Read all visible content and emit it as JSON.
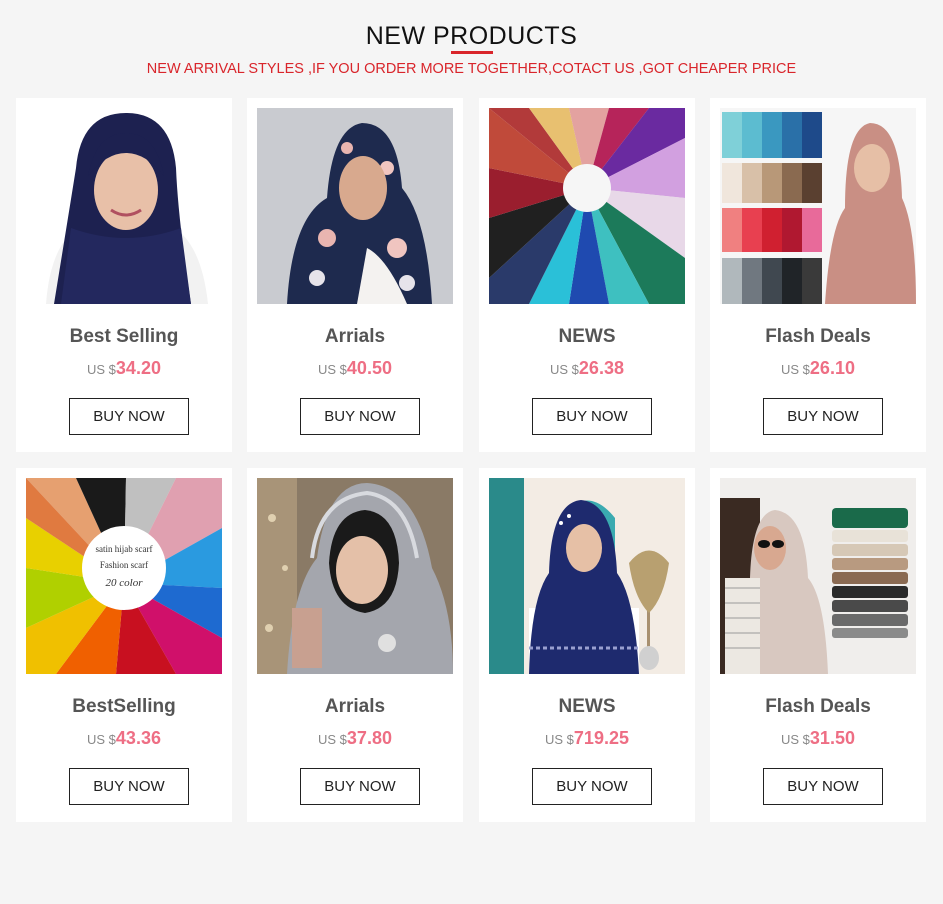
{
  "header": {
    "title": "NEW PRODUCTS",
    "subtitle": "NEW ARRIVAL STYLES ,IF YOU ORDER MORE TOGETHER,COTACT US ,GOT CHEAPER PRICE",
    "accent_color": "#d9252b"
  },
  "price_color": "#ee6e84",
  "products": [
    {
      "category": "Best Selling",
      "currency": "US $",
      "price": "34.20",
      "button": "BUY NOW"
    },
    {
      "category": "Arrials",
      "currency": "US $",
      "price": "40.50",
      "button": "BUY NOW"
    },
    {
      "category": "NEWS",
      "currency": "US $",
      "price": "26.38",
      "button": "BUY NOW"
    },
    {
      "category": "Flash Deals",
      "currency": "US $",
      "price": "26.10",
      "button": "BUY NOW"
    },
    {
      "category": "BestSelling",
      "currency": "US $",
      "price": "43.36",
      "button": "BUY NOW",
      "image_text": [
        "satin hijab scarf",
        "Fashion scarf",
        "20 color"
      ]
    },
    {
      "category": "Arrials",
      "currency": "US $",
      "price": "37.80",
      "button": "BUY NOW"
    },
    {
      "category": "NEWS",
      "currency": "US $",
      "price": "719.25",
      "button": "BUY NOW"
    },
    {
      "category": "Flash Deals",
      "currency": "US $",
      "price": "31.50",
      "button": "BUY NOW"
    }
  ]
}
